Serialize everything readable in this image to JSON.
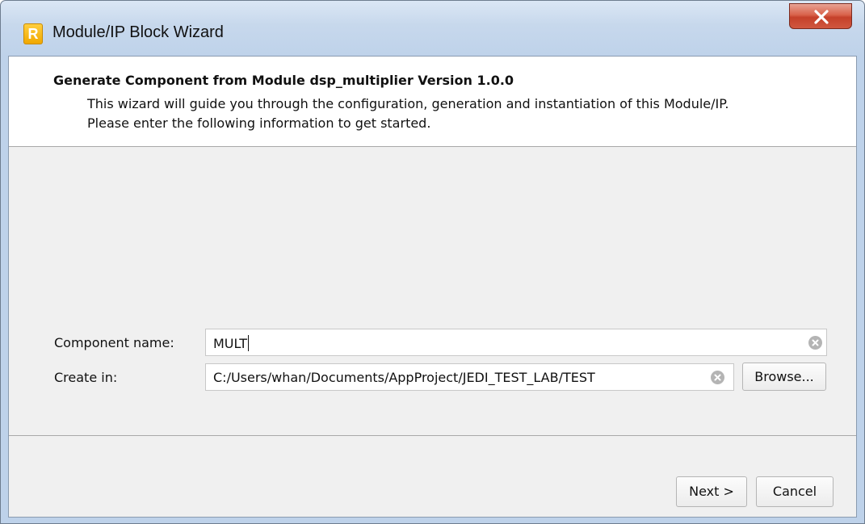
{
  "window": {
    "title": "Module/IP Block Wizard",
    "app_icon_letter": "R",
    "close_icon": "close-icon"
  },
  "header": {
    "title": "Generate Component from Module dsp_multiplier Version 1.0.0",
    "description_line1": "This wizard will guide you through the configuration, generation and instantiation of this Module/IP.",
    "description_line2": "Please enter the following information to get started."
  },
  "form": {
    "component_name_label": "Component name:",
    "component_name_value": "MULT",
    "create_in_label": "Create in:",
    "create_in_value": "C:/Users/whan/Documents/AppProject/JEDI_TEST_LAB/TEST",
    "browse_label": "Browse..."
  },
  "footer": {
    "next_label": "Next >",
    "cancel_label": "Cancel"
  },
  "colors": {
    "title_bar": "#c7d8ec",
    "close_button": "#d0573f",
    "client_background": "#f0f0f0",
    "header_background": "#ffffff"
  }
}
